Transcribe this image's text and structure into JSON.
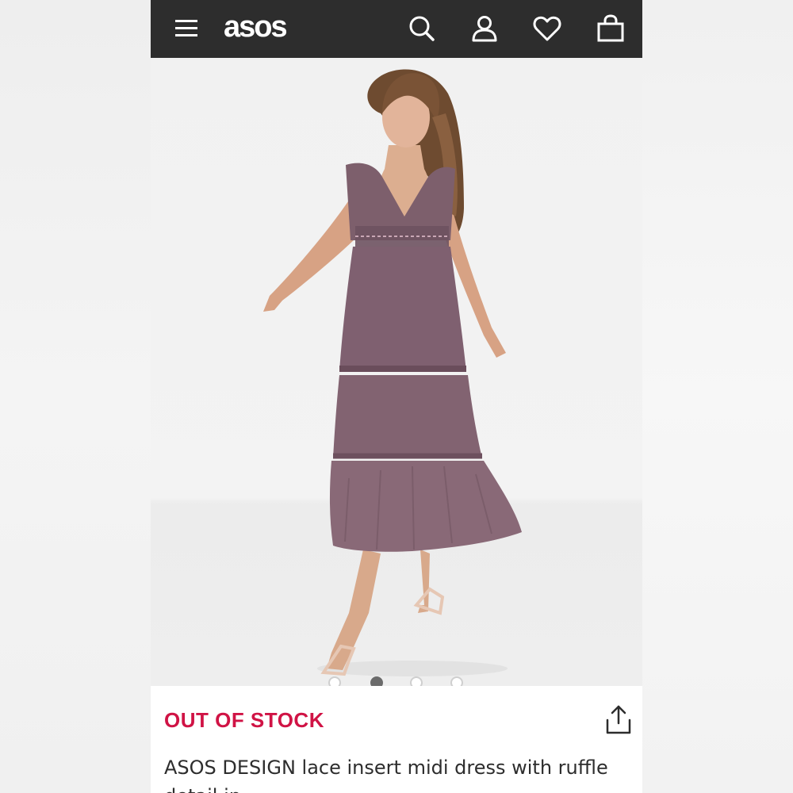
{
  "header": {
    "logo_text": "asos",
    "background": "#2d2d2d",
    "icons": [
      "hamburger-menu-icon",
      "search-icon",
      "account-icon",
      "heart-icon",
      "bag-icon"
    ]
  },
  "gallery": {
    "image_alt": "Model wearing mauve tiered lace insert midi dress",
    "image_count": 4,
    "current_index": 1,
    "dress_color": "#7d5f6c"
  },
  "product": {
    "stock_status": "OUT OF STOCK",
    "stock_color": "#d01345",
    "title": "ASOS DESIGN lace insert midi dress with ruffle detail in",
    "share_icon": "share-icon"
  }
}
